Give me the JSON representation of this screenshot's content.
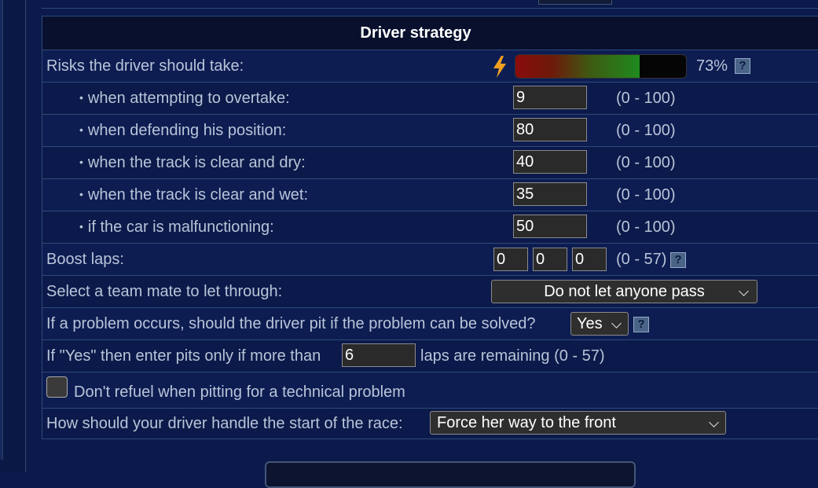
{
  "section_title": "Driver strategy",
  "colors": {
    "background": "#0b1a4a",
    "header": "#08102e",
    "border": "#2f4a78",
    "text": "#b9c4d8",
    "risk_bar_start": "#8a0c0c",
    "risk_bar_end": "#1e8a1e"
  },
  "risks": {
    "label": "Risks the driver should take:",
    "icon": "lightning-bolt-icon",
    "percent_text": "73%",
    "level": 0.73,
    "help": "?"
  },
  "risk_rows": [
    {
      "label": "when attempting to overtake:",
      "value": "9",
      "range": "(0 - 100)"
    },
    {
      "label": "when defending his position:",
      "value": "80",
      "range": "(0 - 100)"
    },
    {
      "label": "when the track is clear and dry:",
      "value": "40",
      "range": "(0 - 100)"
    },
    {
      "label": "when the track is clear and wet:",
      "value": "35",
      "range": "(0 - 100)"
    },
    {
      "label": "if the car is malfunctioning:",
      "value": "50",
      "range": "(0 - 100)"
    }
  ],
  "boost": {
    "label": "Boost laps:",
    "values": [
      "0",
      "0",
      "0"
    ],
    "range": "(0 - 57)",
    "help": "?"
  },
  "teammate": {
    "label": "Select a team mate to let through:",
    "selected": "Do not let anyone pass"
  },
  "pit_problem": {
    "label": "If a problem occurs, should the driver pit if the problem can be solved?",
    "selected": "Yes",
    "help": "?"
  },
  "pit_laps": {
    "prefix": "If \"Yes\" then enter pits only if more than",
    "value": "6",
    "suffix": "laps are remaining (0 - 57)"
  },
  "no_refuel": {
    "label": "Don't refuel when pitting for a technical problem",
    "checked": false
  },
  "start": {
    "label": "How should your driver handle the start of the race:",
    "selected": "Force her way to the front"
  }
}
